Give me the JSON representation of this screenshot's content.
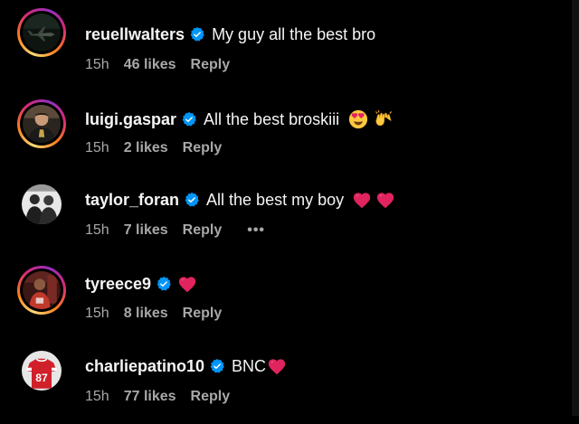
{
  "colors": {
    "background": "#000000",
    "text": "#f5f5f5",
    "secondary_text": "#a8a8a8",
    "verified_blue": "#0095f6",
    "heart_red": "#e0245e"
  },
  "comments": [
    {
      "username": "reuellwalters",
      "verified": true,
      "text": "My guy all the best bro",
      "emojis": [],
      "time": "15h",
      "likes": "46 likes",
      "reply": "Reply",
      "has_story_ring": true,
      "avatar_icon": "fighter-jet-avatar"
    },
    {
      "username": "luigi.gaspar",
      "verified": true,
      "text": "All the best broskiii",
      "emojis": [
        "heart-eyes-emoji",
        "raised-hands-emoji"
      ],
      "time": "15h",
      "likes": "2 likes",
      "reply": "Reply",
      "has_story_ring": true,
      "avatar_icon": "player-photo-avatar"
    },
    {
      "username": "taylor_foran",
      "verified": true,
      "text": "All the best my boy",
      "emojis": [
        "red-heart-emoji",
        "red-heart-emoji"
      ],
      "time": "15h",
      "likes": "7 likes",
      "reply": "Reply",
      "more": "•••",
      "has_story_ring": false,
      "avatar_icon": "bw-group-photo-avatar"
    },
    {
      "username": "tyreece9",
      "verified": true,
      "text": "",
      "emojis": [
        "red-heart-emoji"
      ],
      "time": "15h",
      "likes": "8 likes",
      "reply": "Reply",
      "has_story_ring": true,
      "avatar_icon": "player-seated-avatar"
    },
    {
      "username": "charliepatino10",
      "verified": true,
      "text": "BNC",
      "emojis": [
        "red-heart-emoji"
      ],
      "time": "15h",
      "likes": "77 likes",
      "reply": "Reply",
      "has_story_ring": false,
      "avatar_icon": "jersey-87-avatar",
      "avatar_jersey_number": "87"
    }
  ]
}
